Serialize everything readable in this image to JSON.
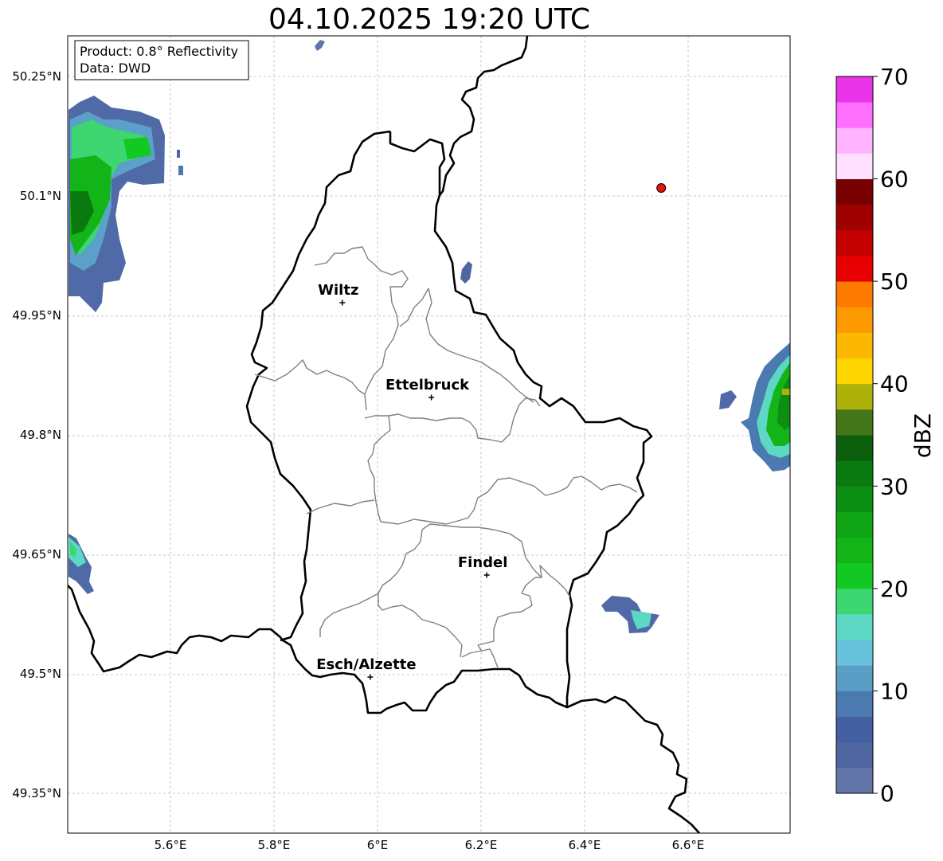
{
  "title": "04.10.2025 19:20 UTC",
  "info_box": {
    "line1": "Product: 0.8° Reflectivity",
    "line2": "Data: DWD"
  },
  "lat_labels": [
    "50.25°N",
    "50.1°N",
    "49.95°N",
    "49.8°N",
    "49.65°N",
    "49.5°N",
    "49.35°N"
  ],
  "lon_labels": [
    "5.6°E",
    "5.8°E",
    "6°E",
    "6.2°E",
    "6.4°E",
    "6.6°E"
  ],
  "cities": [
    {
      "name": "Wiltz",
      "lat": 49.966,
      "lon": 5.932
    },
    {
      "name": "Ettelbruck",
      "lat": 49.847,
      "lon": 6.104
    },
    {
      "name": "Findel",
      "lat": 49.624,
      "lon": 6.211
    },
    {
      "name": "Esch/Alzette",
      "lat": 49.496,
      "lon": 5.986
    }
  ],
  "radar_site": {
    "lat": 50.11,
    "lon": 6.548,
    "color": "#e8120e"
  },
  "colorbar": {
    "label": "dBZ",
    "min": 0,
    "max": 70,
    "step": 2.5,
    "tick_labels": [
      "0",
      "10",
      "20",
      "30",
      "40",
      "50",
      "60",
      "70"
    ],
    "colors": [
      "#6375a8",
      "#5066a0",
      "#4460a2",
      "#4a7ab0",
      "#5a9ec6",
      "#68c2dc",
      "#5cd8c4",
      "#3cd672",
      "#12c822",
      "#12b418",
      "#0ea414",
      "#0c8e12",
      "#0a7a10",
      "#0a5e0c",
      "#44761a",
      "#acb20a",
      "#fdd600",
      "#fcb800",
      "#fc9800",
      "#fc7a00",
      "#e80000",
      "#c40000",
      "#a00000",
      "#780000",
      "#ffe0ff",
      "#ffb4ff",
      "#ff70ff",
      "#ea34ea"
    ]
  }
}
